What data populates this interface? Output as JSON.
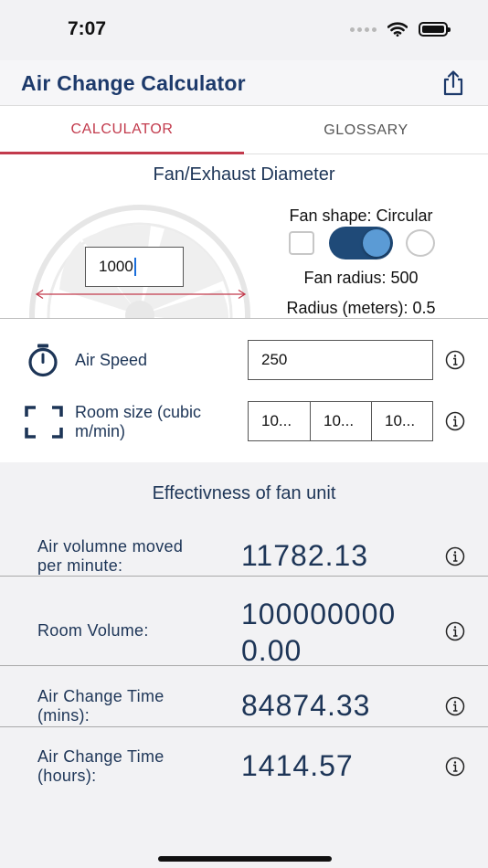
{
  "status_bar": {
    "time": "7:07"
  },
  "nav": {
    "title": "Air Change Calculator",
    "share_icon": "share-icon"
  },
  "tabs": [
    {
      "label": "CALCULATOR",
      "active": true
    },
    {
      "label": "GLOSSARY",
      "active": false
    }
  ],
  "fan": {
    "section_title": "Fan/Exhaust Diameter",
    "diameter_value": "1000",
    "shape_label": "Fan shape: Circular",
    "radius_label": "Fan radius: 500",
    "radius_meters_label": "Radius (meters): 0.5",
    "toggle_on": true
  },
  "inputs": {
    "air_speed": {
      "label": "Air Speed",
      "value": "250",
      "icon": "stopwatch-icon"
    },
    "room_size": {
      "label_line1": "Room size (cubic",
      "label_line2": "m/min)",
      "values": [
        "10...",
        "10...",
        "10..."
      ],
      "icon": "frame-corners-icon"
    }
  },
  "results": {
    "section_title": "Effectivness of fan unit",
    "rows": [
      {
        "label_line1": "Air volumne moved",
        "label_line2": "per minute:",
        "value_line1": "11782.13",
        "value_line2": ""
      },
      {
        "label_line1": "Room Volume:",
        "label_line2": "",
        "value_line1": "100000000",
        "value_line2": "0.00"
      },
      {
        "label_line1": "Air Change Time",
        "label_line2": "(mins):",
        "value_line1": "84874.33",
        "value_line2": ""
      },
      {
        "label_line1": "Air Change Time",
        "label_line2": "(hours):",
        "value_line1": "1414.57",
        "value_line2": ""
      }
    ]
  },
  "colors": {
    "accent_red": "#c23a4c",
    "navy": "#1d3557",
    "toggle_track": "#1f4a78",
    "toggle_knob": "#5b9bd5"
  }
}
